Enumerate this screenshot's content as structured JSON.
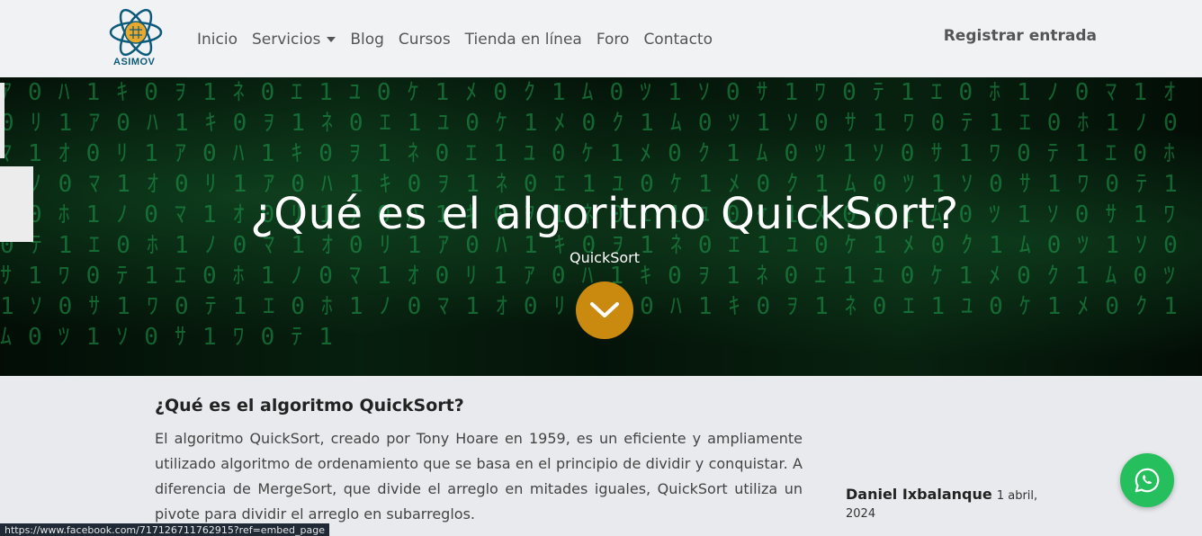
{
  "brand": {
    "name": "ASIMOV"
  },
  "nav": {
    "links": [
      "Inicio",
      "Servicios",
      "Blog",
      "Cursos",
      "Tienda en línea",
      "Foro",
      "Contacto"
    ],
    "signin": "Registrar entrada"
  },
  "hero": {
    "title": "¿Qué es el algoritmo QuickSort?",
    "subtitle": "QuickSort"
  },
  "article": {
    "heading": "¿Qué es el algoritmo QuickSort?",
    "body": "El algoritmo QuickSort, creado por Tony Hoare en 1959, es un eficiente y ampliamente utilizado algoritmo de ordenamiento que se basa en el principio de dividir y conquistar. A diferencia de MergeSort, que divide el arreglo en mitades iguales, QuickSort utiliza un pivote para dividir el arreglo en subarreglos."
  },
  "author": {
    "name": "Daniel Ixbalanque",
    "date": "1 abril, 2024"
  },
  "status_bar": {
    "url": "https://www.facebook.com/717126711762915?ref=embed_page"
  },
  "colors": {
    "accent": "#c98a0f",
    "whatsapp": "#25c05d",
    "nav_bg": "#f1f2f4"
  }
}
